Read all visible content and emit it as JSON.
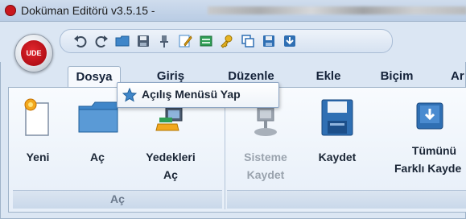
{
  "window": {
    "title": "Doküman Editörü v3.5.15 -"
  },
  "app_menu": {
    "orb_label": "UDE"
  },
  "quick_access": {
    "icons": [
      "undo-icon",
      "redo-icon",
      "folder-open-icon",
      "save-icon",
      "pin-icon",
      "edit-icon",
      "document-icon",
      "key-icon",
      "copy-icon",
      "save-as-icon",
      "download-icon"
    ]
  },
  "tabs": [
    {
      "label": "Dosya",
      "active": true
    },
    {
      "label": "Giriş",
      "active": false
    },
    {
      "label": "Düzenle",
      "active": false
    },
    {
      "label": "Ekle",
      "active": false
    },
    {
      "label": "Biçim",
      "active": false
    },
    {
      "label": "Ar",
      "active": false
    }
  ],
  "popup": {
    "label": "Açılış Menüsü Yap"
  },
  "ribbon": {
    "groups": [
      {
        "label": "Aç",
        "buttons": [
          {
            "label": "Yeni",
            "icon": "new-document-icon",
            "enabled": true
          },
          {
            "label": "Aç",
            "icon": "folder-icon",
            "enabled": true
          },
          {
            "label_line1": "Yedekleri",
            "label_line2": "Aç",
            "icon": "backup-icon",
            "enabled": true
          }
        ]
      },
      {
        "label": "",
        "buttons": [
          {
            "label_line1": "Sisteme",
            "label_line2": "Kaydet",
            "icon": "system-save-icon",
            "enabled": false
          },
          {
            "label": "Kaydet",
            "icon": "floppy-icon",
            "enabled": true
          },
          {
            "label_line1": "Tümünü",
            "label_line2": "Farklı Kayde",
            "icon": "save-all-icon",
            "enabled": true
          }
        ]
      }
    ]
  }
}
